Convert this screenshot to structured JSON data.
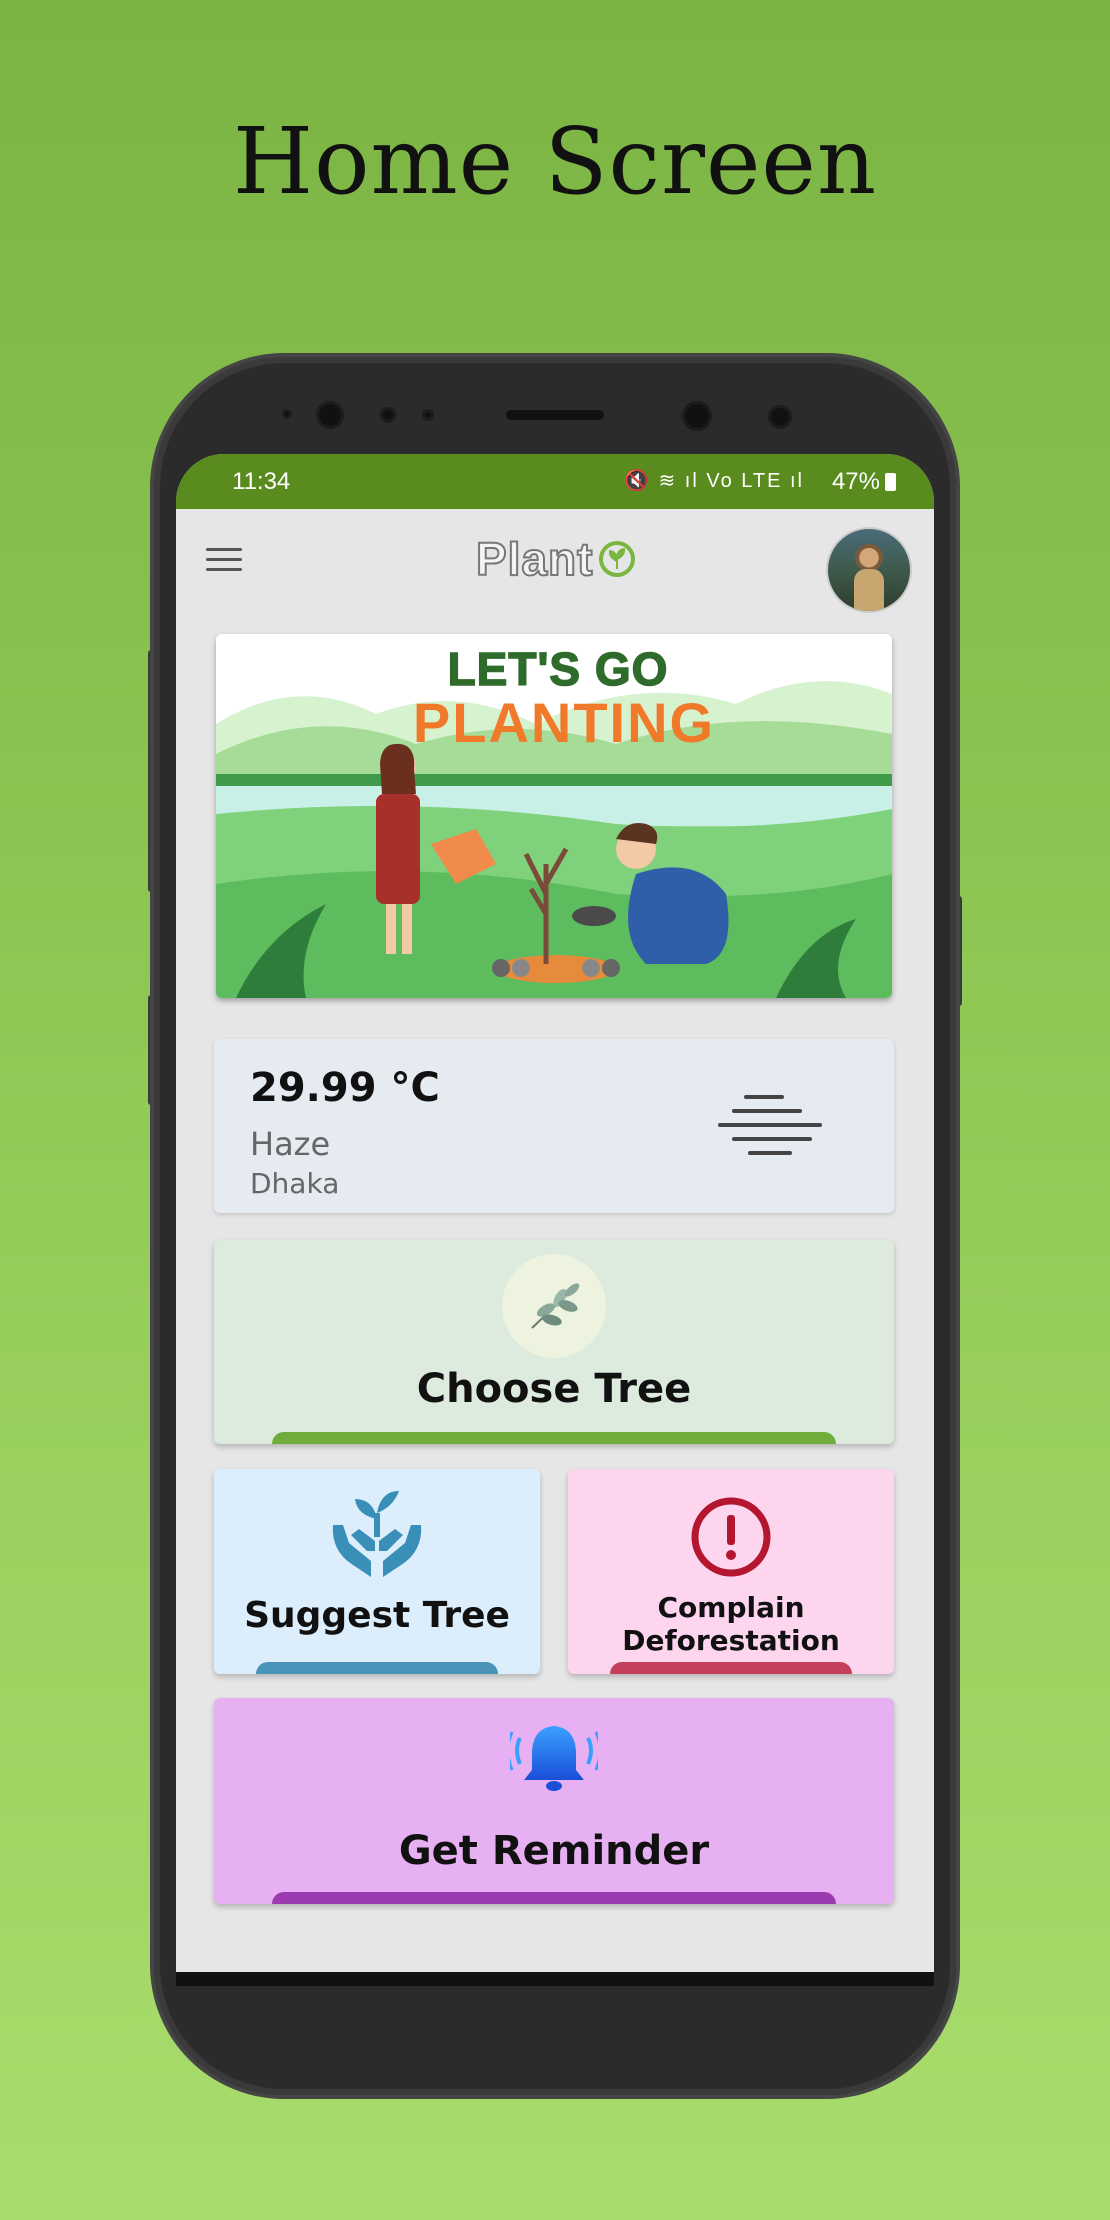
{
  "page": {
    "title": "Home Screen"
  },
  "status_bar": {
    "time": "11:34",
    "battery": "47%",
    "icons": "🔇 ≋ ıl Vo LTE ıl"
  },
  "app_bar": {
    "logo_text": "Plant",
    "menu_icon": "hamburger-menu-icon",
    "avatar_icon": "user-avatar"
  },
  "banner": {
    "line1": "LET'S GO",
    "line2": "PLANTING"
  },
  "weather": {
    "temperature": "29.99 °C",
    "condition": "Haze",
    "city": "Dhaka",
    "icon": "haze-icon"
  },
  "cards": {
    "choose_tree": {
      "label": "Choose Tree",
      "icon": "plant-sprig-icon",
      "bar_color": "#6eac3c",
      "bg": "#dcebdd"
    },
    "suggest_tree": {
      "label": "Suggest Tree",
      "icon": "hands-plant-icon",
      "bar_color": "#4a93b8",
      "bg": "#dcedfc"
    },
    "complain": {
      "label_line1": "Complain",
      "label_line2": "Deforestation",
      "icon": "alert-circle-icon",
      "bar_color": "#c4405a",
      "bg": "#fdd5ef"
    },
    "reminder": {
      "label": "Get Reminder",
      "icon": "bell-ringing-icon",
      "bar_color": "#9c3bb0",
      "bg": "#e6b0f2"
    }
  },
  "colors": {
    "status_bar": "#5a8b1e",
    "background": "#e6e6e6"
  }
}
